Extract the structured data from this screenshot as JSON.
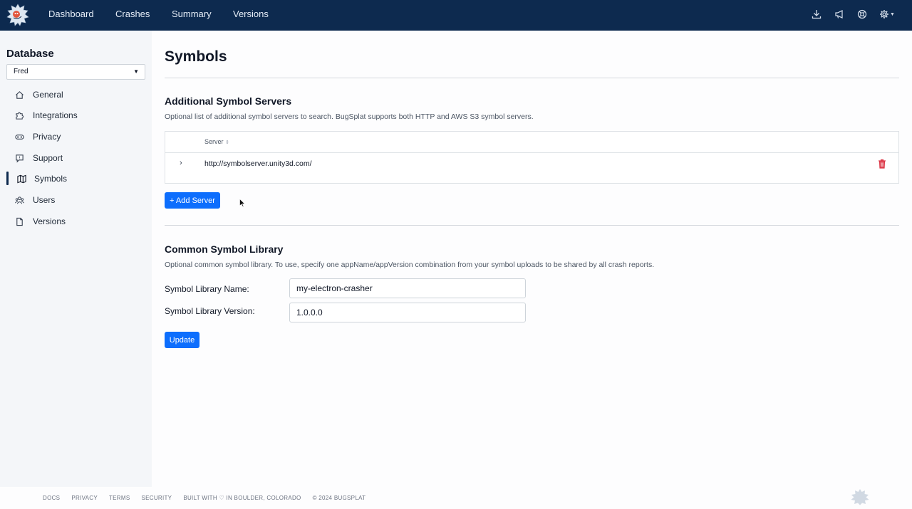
{
  "nav": {
    "items": [
      "Dashboard",
      "Crashes",
      "Summary",
      "Versions"
    ],
    "icons": [
      "download-icon",
      "megaphone-icon",
      "help-circle-icon",
      "settings-icon"
    ]
  },
  "sidebar": {
    "title": "Database",
    "database_selected": "Fred",
    "items": [
      {
        "label": "General",
        "icon": "home-icon"
      },
      {
        "label": "Integrations",
        "icon": "puzzle-icon"
      },
      {
        "label": "Privacy",
        "icon": "mask-icon"
      },
      {
        "label": "Support",
        "icon": "chat-icon"
      },
      {
        "label": "Symbols",
        "icon": "map-icon",
        "active": true
      },
      {
        "label": "Users",
        "icon": "users-icon"
      },
      {
        "label": "Versions",
        "icon": "file-icon"
      }
    ]
  },
  "main": {
    "title": "Symbols",
    "servers": {
      "title": "Additional Symbol Servers",
      "description": "Optional list of additional symbol servers to search. BugSplat supports both HTTP and AWS S3 symbol servers.",
      "column_header": "Server",
      "rows": [
        "http://symbolserver.unity3d.com/"
      ],
      "add_label": "+ Add Server"
    },
    "library": {
      "title": "Common Symbol Library",
      "description": "Optional common symbol library. To use, specify one appName/appVersion combination from your symbol uploads to be shared by all crash reports.",
      "name_label": "Symbol Library Name:",
      "name_value": "my-electron-crasher",
      "version_label": "Symbol Library Version:",
      "version_value": "1.0.0.0",
      "update_label": "Update"
    }
  },
  "footer": {
    "links": [
      "DOCS",
      "PRIVACY",
      "TERMS",
      "SECURITY",
      "BUILT WITH ♡ IN BOULDER, COLORADO",
      "© 2024 BUGSPLAT"
    ]
  },
  "colors": {
    "navbar": "#0d2a4f",
    "primary": "#0d6efd",
    "danger": "#dc3545"
  }
}
